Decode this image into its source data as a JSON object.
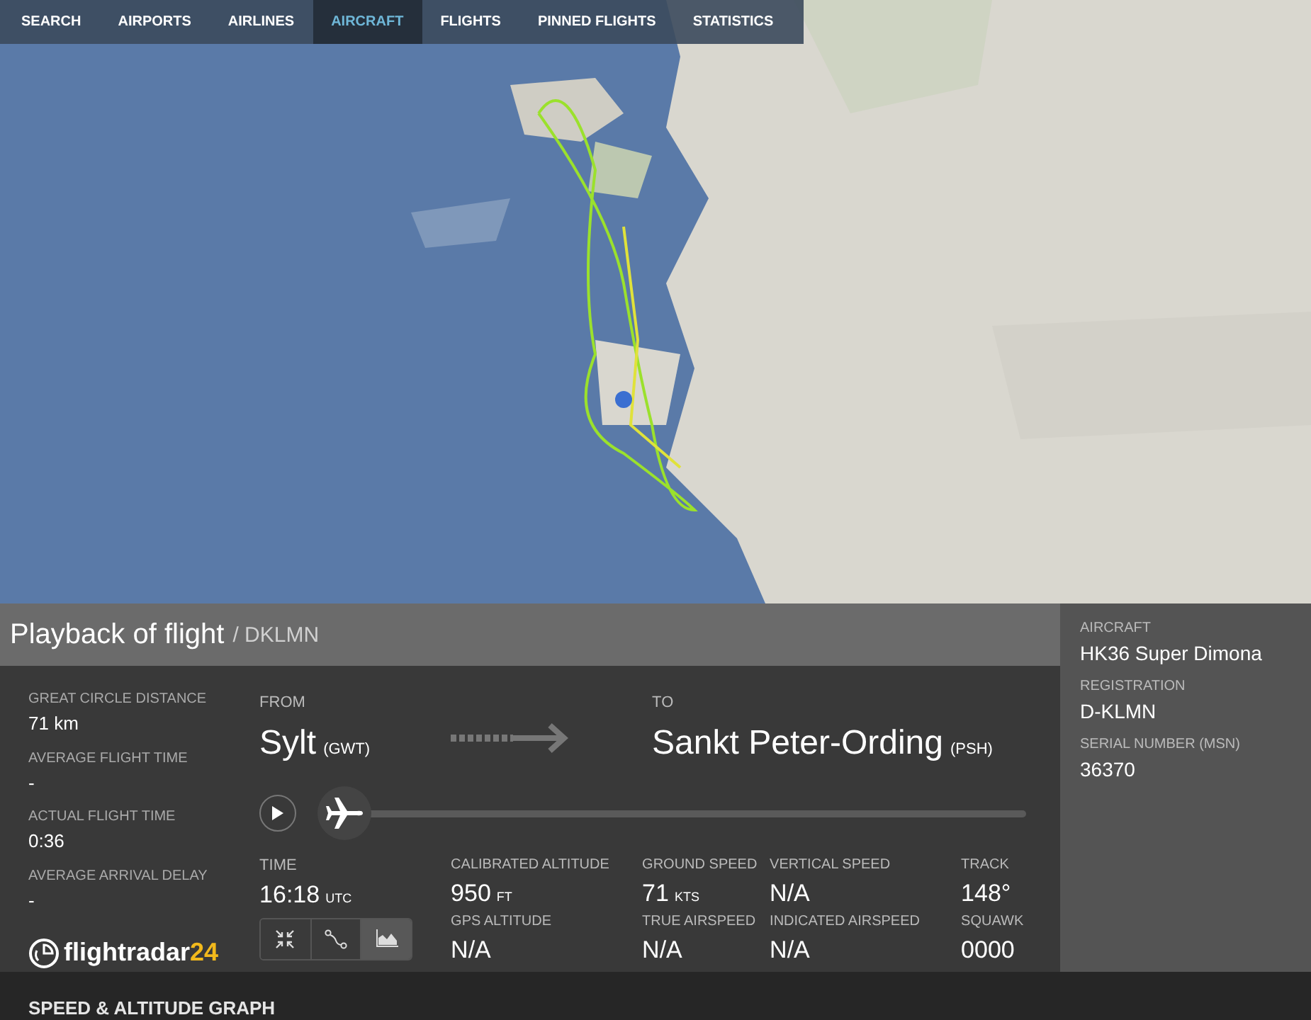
{
  "nav_tabs": [
    {
      "label": "SEARCH",
      "selected": false
    },
    {
      "label": "AIRPORTS",
      "selected": false
    },
    {
      "label": "AIRLINES",
      "selected": false
    },
    {
      "label": "AIRCRAFT",
      "selected": true
    },
    {
      "label": "FLIGHTS",
      "selected": false
    },
    {
      "label": "PINNED FLIGHTS",
      "selected": false
    },
    {
      "label": "STATISTICS",
      "selected": false
    }
  ],
  "playback": {
    "title": "Playback of flight",
    "flight": "/ DKLMN"
  },
  "stats": [
    {
      "label": "GREAT CIRCLE DISTANCE",
      "value": "71 km"
    },
    {
      "label": "AVERAGE FLIGHT TIME",
      "value": "-"
    },
    {
      "label": "ACTUAL FLIGHT TIME",
      "value": "0:36"
    },
    {
      "label": "AVERAGE ARRIVAL DELAY",
      "value": "-"
    }
  ],
  "logo": {
    "text": "flightradar",
    "number": "24"
  },
  "route": {
    "from_label": "FROM",
    "from_city": "Sylt",
    "from_code": "(GWT)",
    "to_label": "TO",
    "to_city": "Sankt Peter-Ording",
    "to_code": "(PSH)"
  },
  "timeline": {
    "level": 0.02
  },
  "time": {
    "label": "TIME",
    "value": "16:18",
    "unit": "UTC"
  },
  "view_buttons": [
    {
      "kind": "collapse",
      "selected": false
    },
    {
      "kind": "route",
      "selected": false
    },
    {
      "kind": "graph",
      "selected": true
    }
  ],
  "readings": [
    {
      "label": "CALIBRATED ALTITUDE",
      "value": "950",
      "unit": "FT"
    },
    {
      "label": "GPS ALTITUDE",
      "value": "N/A"
    },
    {
      "label": "GROUND SPEED",
      "value": "71",
      "unit": "KTS"
    },
    {
      "label": "TRUE AIRSPEED",
      "value": "N/A"
    },
    {
      "label": "VERTICAL SPEED",
      "value": "N/A"
    },
    {
      "label": "INDICATED AIRSPEED",
      "value": "N/A"
    },
    {
      "label": "TRACK",
      "value": "148°"
    },
    {
      "label": "SQUAWK",
      "value": "0000"
    }
  ],
  "aircraft_info": [
    {
      "label": "AIRCRAFT",
      "value": "HK36 Super Dimona"
    },
    {
      "label": "REGISTRATION",
      "value": "D-KLMN"
    },
    {
      "label": "SERIAL NUMBER (MSN)",
      "value": "36370"
    }
  ],
  "graph_section": {
    "title": "SPEED & ALTITUDE GRAPH"
  }
}
